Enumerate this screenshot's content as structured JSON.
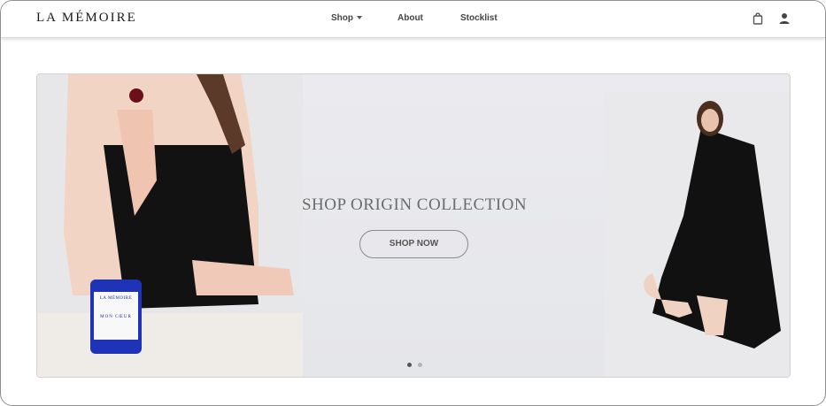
{
  "header": {
    "logo": "LA MÉMOIRE",
    "nav": [
      {
        "label": "Shop"
      },
      {
        "label": "About"
      },
      {
        "label": "Stocklist"
      }
    ],
    "icons": [
      "shopping-bag-icon",
      "user-icon"
    ]
  },
  "hero": {
    "title": "SHOP ORIGIN COLLECTION",
    "button": "SHOP NOW",
    "slides": {
      "count": 2,
      "active": 1
    },
    "candle": {
      "brand": "LA MÉMOIRE",
      "name": "MON CŒUR"
    }
  },
  "colors": {
    "title": "#6b6b6b",
    "candle_blue": "#1b2aa3",
    "background": "#e7e8ec"
  }
}
